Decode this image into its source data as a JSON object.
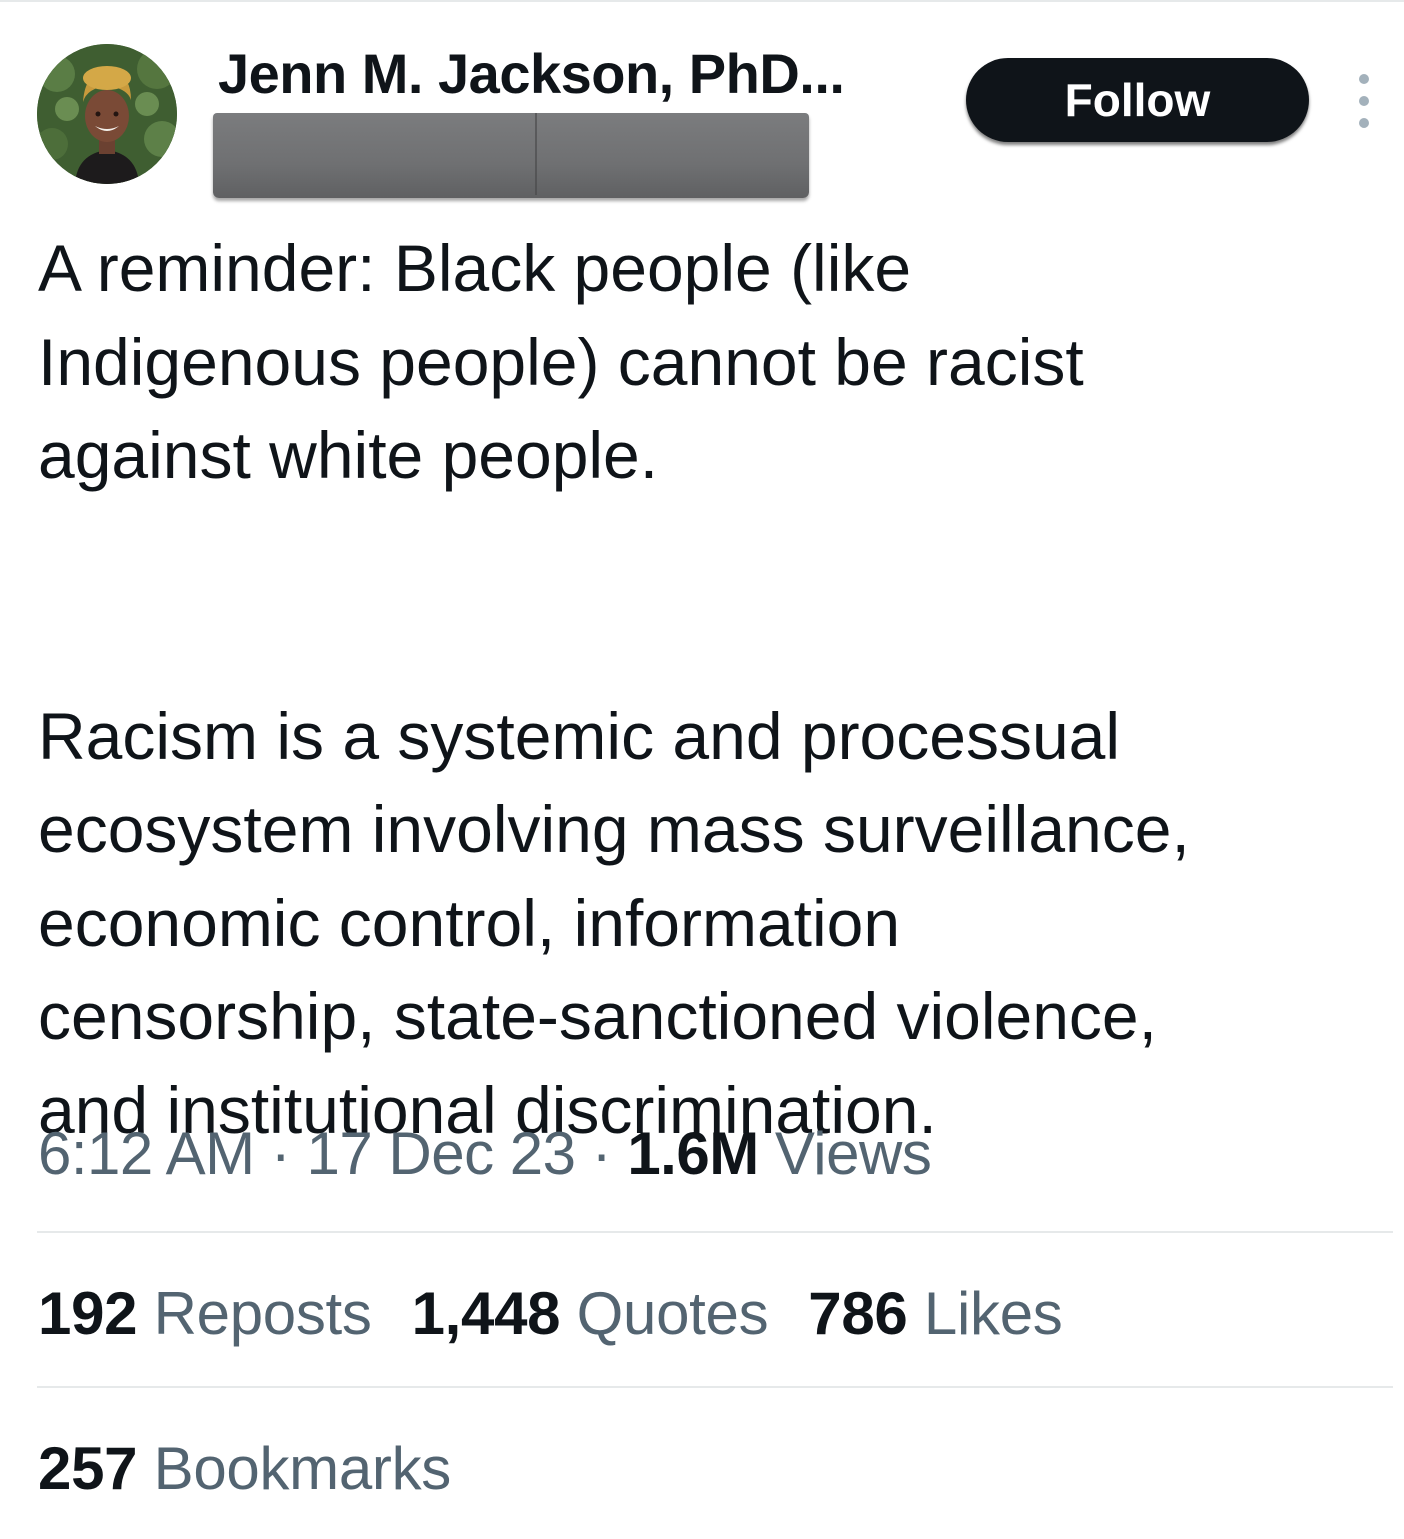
{
  "author": {
    "display_name": "Jenn M. Jackson, PhD...",
    "avatar_icon": "profile-photo"
  },
  "actions": {
    "follow_label": "Follow",
    "more_icon": "more-vertical-icon"
  },
  "tweet": {
    "paragraph_1": [
      "A reminder: Black people (like",
      "Indigenous people) cannot be racist",
      "against white people."
    ],
    "paragraph_2": [
      "Racism is a systemic and processual",
      "ecosystem involving mass surveillance,",
      "economic control, information",
      "censorship, state-sanctioned violence,",
      "and institutional discrimination."
    ]
  },
  "meta": {
    "time": "6:12 AM",
    "separator": " · ",
    "date": "17 Dec 23",
    "views_count": "1.6M",
    "views_label": "Views"
  },
  "stats": {
    "reposts_count": "192",
    "reposts_label": "Reposts",
    "quotes_count": "1,448",
    "quotes_label": "Quotes",
    "likes_count": "786",
    "likes_label": "Likes",
    "bookmarks_count": "257",
    "bookmarks_label": "Bookmarks"
  },
  "colors": {
    "text_primary": "#0f1419",
    "text_secondary": "#536471",
    "divider": "#e6e9ea",
    "follow_bg": "#0f1419",
    "follow_text": "#ffffff"
  }
}
